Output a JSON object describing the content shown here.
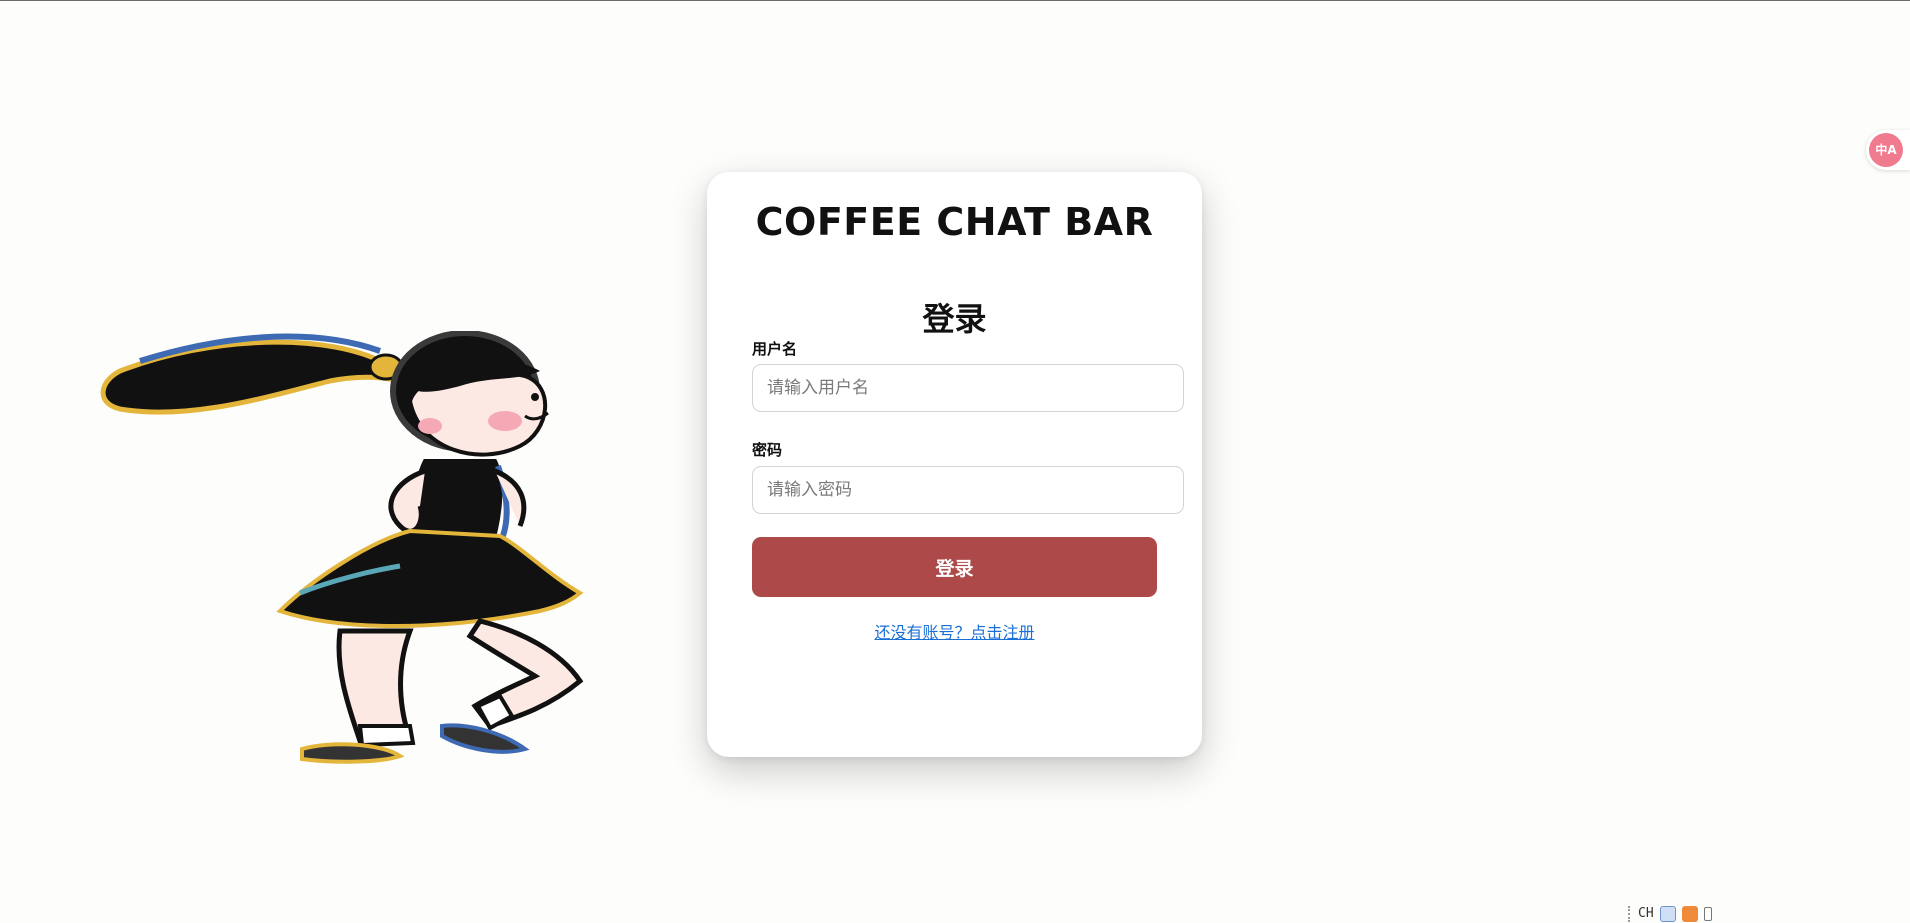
{
  "app": {
    "title": "COFFEE CHAT BAR"
  },
  "login": {
    "heading": "登录",
    "username_label": "用户名",
    "username_placeholder": "请输入用户名",
    "username_value": "",
    "password_label": "密码",
    "password_placeholder": "请输入密码",
    "password_value": "",
    "submit_label": "登录",
    "register_link": "还没有账号？点击注册"
  },
  "translate_widget": {
    "icon": "translate-icon",
    "glyph": "中A"
  },
  "ime_bar": {
    "mode_label": "CH",
    "icons": [
      "pen-icon",
      "sogou-icon",
      "settings-icon"
    ]
  },
  "colors": {
    "primary_button": "#ad4a49",
    "link": "#1a6fd6",
    "background": "#fdfdfb",
    "translate_badge": "#f07b8e"
  }
}
